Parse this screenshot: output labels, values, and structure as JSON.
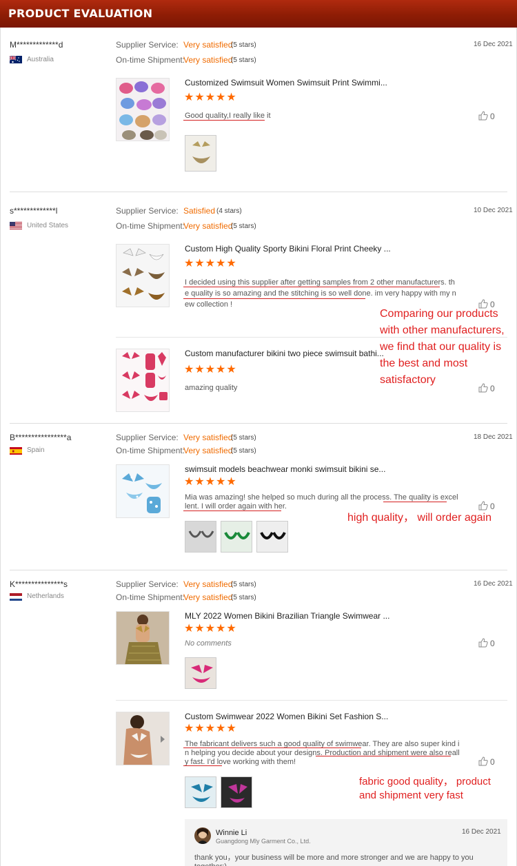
{
  "header": {
    "title": "PRODUCT EVALUATION"
  },
  "labels": {
    "supplier_service": "Supplier Service:",
    "ontime_shipment": "On-time Shipment:"
  },
  "stars": "★★★★★",
  "reviews": [
    {
      "reviewer": "M*************d",
      "country": "Australia",
      "service": "Very satisfied",
      "service_stars": "(5 stars)",
      "shipment": "Very satisfied",
      "shipment_stars": "(5 stars)",
      "date": "16 Dec 2021",
      "products": [
        {
          "name": "Customized Swimsuit Women Swimsuit Print Swimmi...",
          "comment_lines": [
            "Good quality,I really like it"
          ],
          "likes": "0"
        }
      ]
    },
    {
      "reviewer": "s*************l",
      "country": "United States",
      "service": "Satisfied",
      "service_stars": "(4 stars)",
      "shipment": "Very satisfied",
      "shipment_stars": "(5 stars)",
      "date": "10 Dec 2021",
      "products": [
        {
          "name": "Custom High Quality Sporty Bikini Floral Print Cheeky ...",
          "comment_lines": [
            "I decided using this supplier after getting samples from 2 other manufacturers. th",
            "e quality is so amazing and the stitching is so well done. im very happy with my n",
            "ew collection !"
          ],
          "likes": "0"
        },
        {
          "name": "Custom manufacturer bikini two piece swimsuit bathi...",
          "comment_lines": [
            "amazing quality"
          ],
          "likes": "0"
        }
      ]
    },
    {
      "reviewer": "B****************a",
      "country": "Spain",
      "service": "Very satisfied",
      "service_stars": "(5 stars)",
      "shipment": "Very satisfied",
      "shipment_stars": "(5 stars)",
      "date": "18 Dec 2021",
      "products": [
        {
          "name": "swimsuit models beachwear monki swimsuit bikini se...",
          "comment_lines": [
            "Mia was amazing! she helped so much during all the process.  The quality is excel",
            "lent. I will order again with her."
          ],
          "likes": "0"
        }
      ]
    },
    {
      "reviewer": "K***************s",
      "country": "Netherlands",
      "service": "Very satisfied",
      "service_stars": "(5 stars)",
      "shipment": "Very satisfied",
      "shipment_stars": "(5 stars)",
      "date": "16 Dec 2021",
      "products": [
        {
          "name": "MLY 2022 Women Bikini Brazilian Triangle Swimwear ...",
          "comment_lines": [
            "No comments"
          ],
          "likes": "0"
        },
        {
          "name": "Custom Swimwear 2022 Women Bikini Set Fashion S...",
          "comment_lines": [
            "The fabricant delivers such a good quality of swimwear. They are also super kind i",
            "n helping you decide about your designs. Production and shipment were also reall",
            "y fast. I'd love working with them!"
          ],
          "likes": "0"
        }
      ]
    }
  ],
  "annotations": {
    "a1": [
      "Comparing our products",
      "with other manufacturers,",
      "we find that our quality is",
      "the best and most",
      "satisfactory"
    ],
    "a2": "high quality， will order again",
    "a3": [
      "fabric good quality，  product",
      "and shipment very fast"
    ]
  },
  "reply": {
    "name": "Winnie Li",
    "company": "Guangdong Mly Garment Co., Ltd.",
    "date": "16 Dec 2021",
    "text": "thank you，your business will be more and more stronger and we are happy to you together:)"
  },
  "colors": {
    "accent": "#f06b00",
    "header": "#8e1d05",
    "annotation": "#e02020",
    "stars": "#ff6a00"
  },
  "icons": {
    "like": "thumbs-up-icon"
  }
}
